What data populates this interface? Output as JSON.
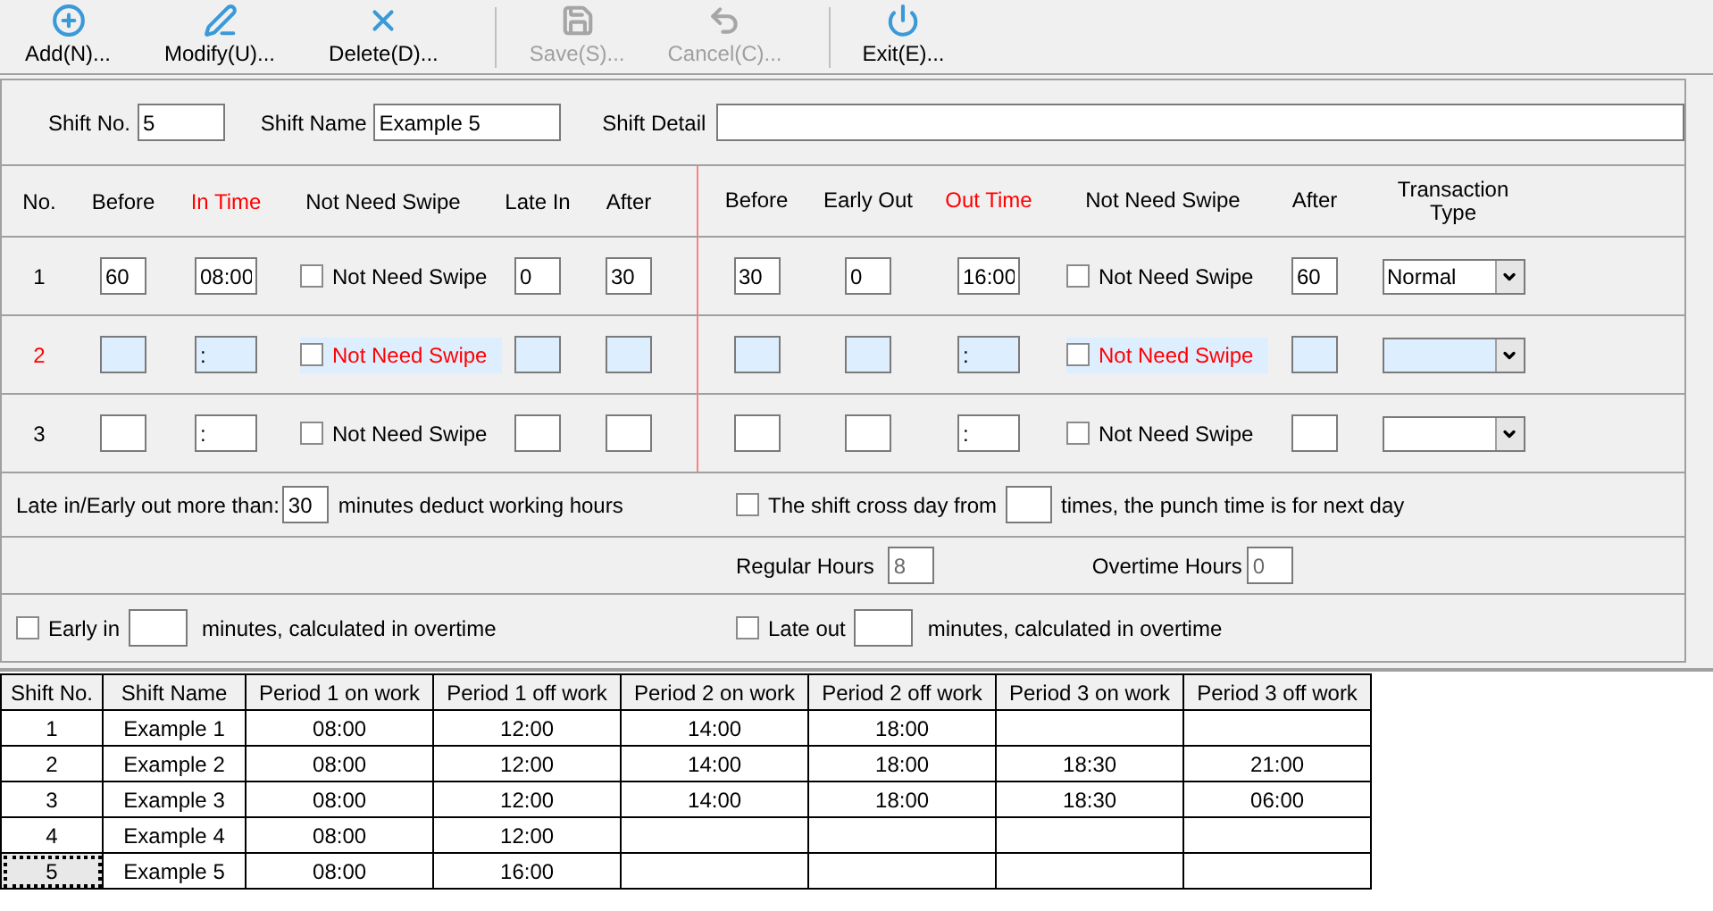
{
  "toolbar": [
    {
      "label": "Add(N)...",
      "disabled": false
    },
    {
      "label": "Modify(U)...",
      "disabled": false
    },
    {
      "label": "Delete(D)...",
      "disabled": false
    },
    {
      "label": "Save(S)...",
      "disabled": true
    },
    {
      "label": "Cancel(C)...",
      "disabled": true
    },
    {
      "label": "Exit(E)...",
      "disabled": false
    }
  ],
  "shift": {
    "no_label": "Shift No.",
    "no": "5",
    "name_label": "Shift Name",
    "name": "Example 5",
    "detail_label": "Shift Detail"
  },
  "period_headers": {
    "left": [
      "No.",
      "Before",
      "In Time",
      "Not Need Swipe",
      "Late In",
      "After"
    ],
    "right": [
      "Before",
      "Early Out",
      "Out Time",
      "Not Need Swipe",
      "After",
      "Transaction Type"
    ]
  },
  "periods": [
    {
      "no": "1",
      "selected": false,
      "before_in": "60",
      "in_time": "08:00",
      "in_swipe": {
        "label": "Not Need Swipe",
        "checked": false
      },
      "late_in": "0",
      "after_in": "30",
      "before_out": "30",
      "early_out": "0",
      "out_time": "16:00",
      "out_swipe": {
        "label": "Not Need Swipe",
        "checked": false
      },
      "after_out": "60",
      "transaction_type": "Normal"
    },
    {
      "no": "2",
      "selected": true,
      "in_time": ":",
      "in_swipe": {
        "label": "Not Need Swipe",
        "checked": false
      },
      "out_time": ":",
      "out_swipe": {
        "label": "Not Need Swipe",
        "checked": false
      }
    },
    {
      "no": "3",
      "selected": false,
      "in_time": ":",
      "in_swipe": {
        "label": "Not Need Swipe",
        "checked": false
      },
      "out_time": ":",
      "out_swipe": {
        "label": "Not Need Swipe",
        "checked": false
      }
    }
  ],
  "late_deduct": {
    "label_before": "Late in/Early out more than:",
    "value": "30",
    "label_after": "minutes deduct working hours"
  },
  "cross_day": {
    "checked": false,
    "label_before": "The shift cross day from",
    "label_after": "times, the punch time is for next day"
  },
  "regular_hours": {
    "label": "Regular Hours",
    "value": "8"
  },
  "overtime_hours": {
    "label": "Overtime Hours",
    "value": "0"
  },
  "early_in": {
    "checked": false,
    "label_before": "Early in",
    "label_after": "minutes, calculated in overtime"
  },
  "late_out": {
    "checked": false,
    "label_before": "Late out",
    "label_after": "minutes, calculated in overtime"
  },
  "table": {
    "columns": [
      "Shift No.",
      "Shift Name",
      "Period 1 on work",
      "Period 1 off work",
      "Period 2 on work",
      "Period 2 off work",
      "Period 3 on work",
      "Period 3 off work"
    ],
    "rows": [
      {
        "selected": false,
        "cells": [
          "1",
          "Example 1",
          "08:00",
          "12:00",
          "14:00",
          "18:00",
          null,
          null
        ]
      },
      {
        "selected": false,
        "cells": [
          "2",
          "Example 2",
          "08:00",
          "12:00",
          "14:00",
          "18:00",
          "18:30",
          "21:00"
        ]
      },
      {
        "selected": false,
        "cells": [
          "3",
          "Example 3",
          "08:00",
          "12:00",
          "14:00",
          "18:00",
          "18:30",
          "06:00"
        ]
      },
      {
        "selected": false,
        "cells": [
          "4",
          "Example 4",
          "08:00",
          "12:00",
          null,
          null,
          null,
          null
        ]
      },
      {
        "selected": true,
        "cells": [
          "5",
          "Example 5",
          "08:00",
          "16:00",
          null,
          null,
          null,
          null
        ]
      }
    ]
  }
}
